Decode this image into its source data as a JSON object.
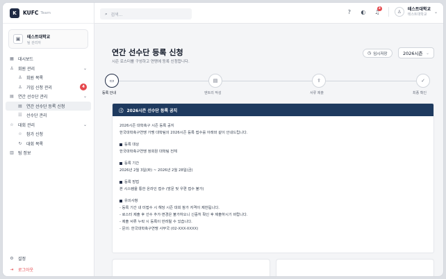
{
  "brand": {
    "logo": "K",
    "name": "KUFC",
    "sub": "Team"
  },
  "org": {
    "icon": "building-icon",
    "name": "테스트대학교",
    "role": "팀 관리자"
  },
  "sidebar": {
    "items": [
      {
        "label": "대시보드",
        "icon": "▦"
      },
      {
        "label": "회원 관리",
        "icon": "♙"
      },
      {
        "label": "회원 목록",
        "icon": "♙"
      },
      {
        "label": "가입 신청 관리",
        "icon": "♙",
        "badge": "4"
      },
      {
        "label": "연간 선수단 관리",
        "icon": "▤"
      },
      {
        "label": "연간 선수단 등록 신청",
        "icon": "▤"
      },
      {
        "label": "선수단 관리",
        "icon": "☷"
      },
      {
        "label": "대회 관리",
        "icon": "☆"
      },
      {
        "label": "참가 신청",
        "icon": "☆"
      },
      {
        "label": "대회 목록",
        "icon": "↻"
      },
      {
        "label": "팀 정보",
        "icon": "▥"
      }
    ],
    "bottom": [
      {
        "label": "설정",
        "icon": "⚙"
      },
      {
        "label": "로그아웃",
        "icon": "⇥"
      }
    ]
  },
  "topbar": {
    "search_placeholder": "검색...",
    "notification_count": "3",
    "user_name": "테스트대학교",
    "user_sub": "테스트대학교"
  },
  "page": {
    "title": "연간 선수단 등록 신청",
    "description": "시즌 로스터를 구성하고 연맹에 등록 신청합니다.",
    "draft_button": "임시저장",
    "season": "2026시즌"
  },
  "steps": [
    {
      "label": "등록 안내",
      "icon": "▭"
    },
    {
      "label": "엔트리 작성",
      "icon": "▤"
    },
    {
      "label": "서류 제출",
      "icon": "⇪"
    },
    {
      "label": "최종 확인",
      "icon": "✓"
    }
  ],
  "notice": {
    "title": "2026시즌 선수단 등록 공지",
    "intro_1": "2026시즌 대학축구 시즌 등록 공지",
    "intro_2": "한국대학축구연맹 가맹 대학팀의 2026시즌 등록 접수를 아래와 같이 안내드립니다.",
    "target_title": "등록 대상",
    "target_text": "한국대학축구연맹 정회원 대학팀 전체",
    "period_title": "등록 기간",
    "period_text": "2026년 2월 3일(화) ~ 2026년 2월 28일(금)",
    "method_title": "등록 방법",
    "method_text": "본 시스템을 통한 온라인 접수 (방문 및 우편 접수 불가)",
    "caution_title": "유의사항",
    "caution_1": "- 등록 기간 내 미접수 시 해당 시즌 대회 참가 자격이 제한됩니다.",
    "caution_2": "- 로스터 제출 후 선수 추가·변경은 불가하오니 신중히 확인 후 제출하시기 바랍니다.",
    "caution_3": "- 제출 서류 누락 시 등록이 반려될 수 있습니다.",
    "caution_4": "- 문의: 한국대학축구연맹 사무국 (02-XXX-XXXX)"
  }
}
